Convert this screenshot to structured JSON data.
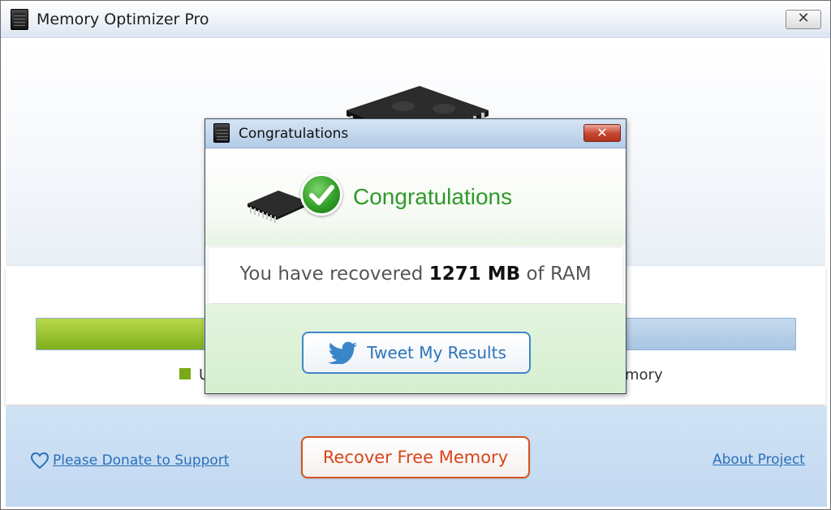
{
  "main_window": {
    "title": "Memory Optimizer Pro",
    "close_label": "✕"
  },
  "memory_bar": {
    "used_fraction": 0.22,
    "legend_used_label": "U",
    "legend_free_label": "mory"
  },
  "footer": {
    "donate_label": "Please Donate to Support",
    "recover_label": "Recover Free Memory",
    "about_label": "About Project"
  },
  "dialog": {
    "title": "Congratulations",
    "close_label": "✕",
    "heading": "Congratulations",
    "result_prefix": "You have recovered ",
    "result_amount": "1271 MB",
    "result_suffix": " of RAM",
    "tweet_label": "Tweet My Results"
  },
  "colors": {
    "accent_green": "#2f9a2a",
    "link_blue": "#2a6fb8",
    "recover_orange": "#d8461a",
    "twitter_blue": "#2d73b9"
  },
  "icons": [
    "app-icon",
    "chip-icon",
    "check-icon",
    "heart-icon",
    "twitter-bird-icon",
    "close-icon"
  ]
}
